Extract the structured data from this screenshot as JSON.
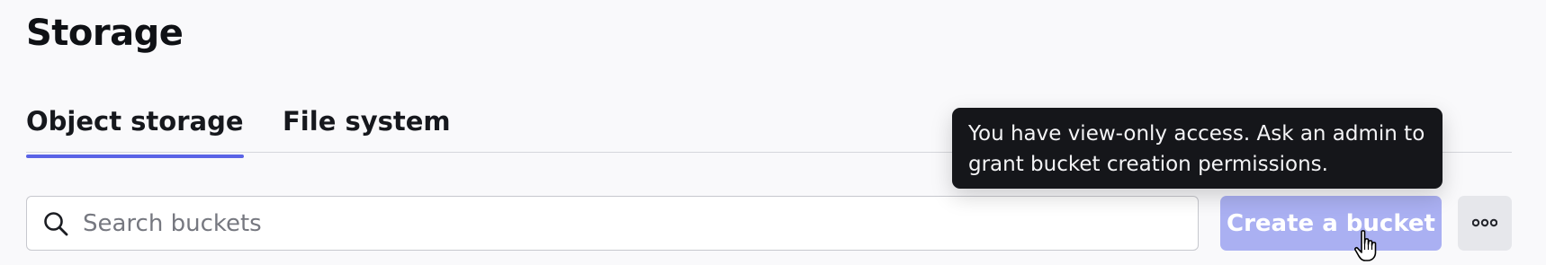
{
  "page": {
    "title": "Storage"
  },
  "tabs": [
    {
      "label": "Object storage",
      "active": true
    },
    {
      "label": "File system",
      "active": false
    }
  ],
  "search": {
    "value": "",
    "placeholder": "Search buckets",
    "icon": "search-icon"
  },
  "actions": {
    "create_label": "Create a bucket",
    "create_disabled": true,
    "more_icon": "more-horizontal-icon"
  },
  "tooltip": {
    "text": "You have view-only access. Ask an admin to grant bucket creation permissions."
  },
  "colors": {
    "accent": "#5a63e6",
    "button_disabled": "#aab0f2",
    "tooltip_bg": "#15161a"
  }
}
